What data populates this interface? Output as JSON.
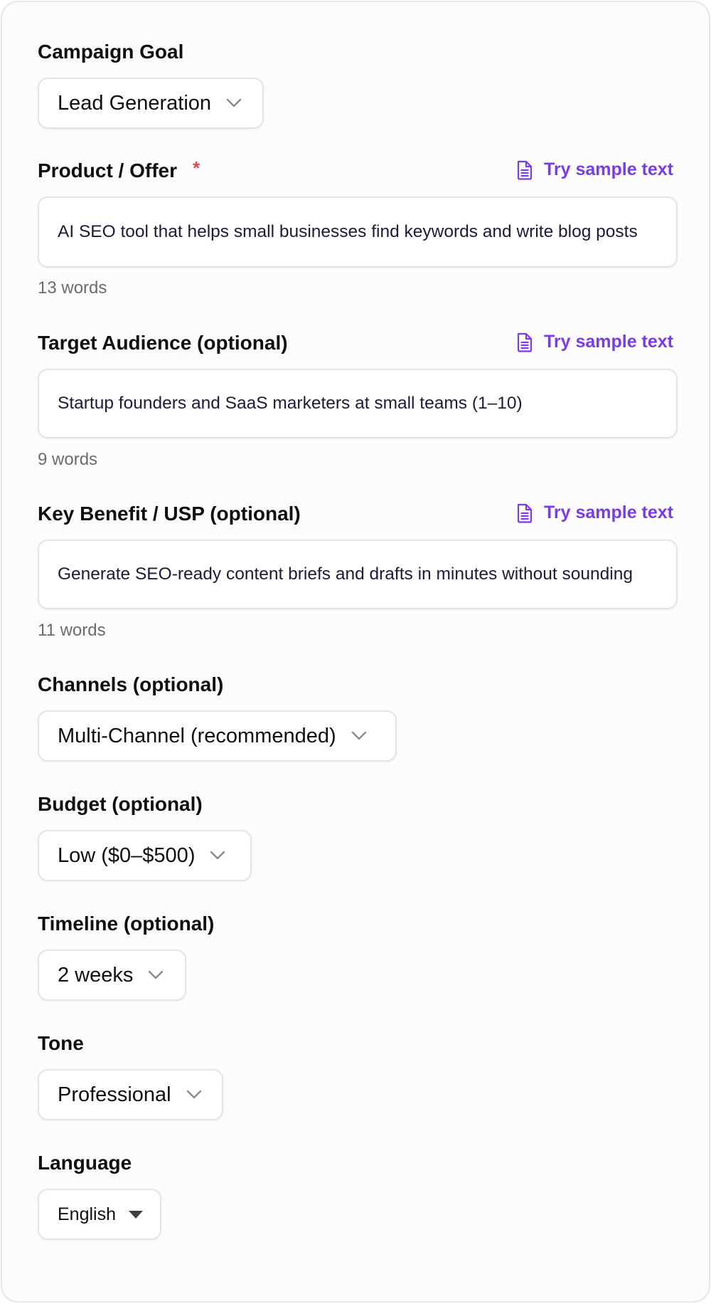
{
  "campaign_goal": {
    "label": "Campaign Goal",
    "value": "Lead Generation"
  },
  "product_offer": {
    "label": "Product / Offer",
    "required_mark": "*",
    "sample_link": "Try sample text",
    "value": "AI SEO tool that helps small businesses find keywords and write blog posts",
    "word_count": "13 words"
  },
  "target_audience": {
    "label": "Target Audience (optional)",
    "sample_link": "Try sample text",
    "value": "Startup founders and SaaS marketers at small teams (1–10)",
    "word_count": "9 words"
  },
  "key_benefit": {
    "label": "Key Benefit / USP (optional)",
    "sample_link": "Try sample text",
    "value": "Generate SEO-ready content briefs and drafts in minutes without sounding",
    "word_count": "11 words"
  },
  "channels": {
    "label": "Channels (optional)",
    "value": "Multi-Channel (recommended)"
  },
  "budget": {
    "label": "Budget (optional)",
    "value": "Low ($0–$500)"
  },
  "timeline": {
    "label": "Timeline (optional)",
    "value": "2 weeks"
  },
  "tone": {
    "label": "Tone",
    "value": "Professional"
  },
  "language": {
    "label": "Language",
    "value": "English"
  },
  "colors": {
    "accent": "#7c3aed",
    "required": "#e5484d",
    "border": "#e4e4e7",
    "muted_text": "#6b6b72"
  },
  "icons": {
    "dropdown": "chevron-down-icon",
    "sample": "document-icon",
    "native_dropdown": "caret-down-icon"
  }
}
